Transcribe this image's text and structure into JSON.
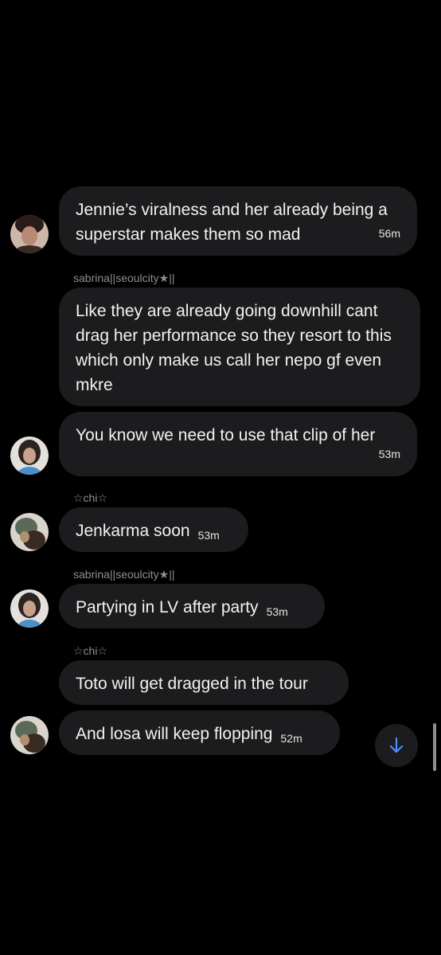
{
  "messages": [
    {
      "sender": "",
      "text": "Jennie’s viralness and her already being a superstar makes them so mad",
      "time": "56m"
    },
    {
      "sender": "sabrina||seoulcity★||",
      "text": "Like they are already going downhill cant drag her performance so they resort to this which only make us call her nepo gf even mkre",
      "time": ""
    },
    {
      "sender": "",
      "text": "You know we need to use that clip of her",
      "time": "53m"
    },
    {
      "sender": "☆chi☆",
      "text": "Jenkarma soon",
      "time": "53m"
    },
    {
      "sender": "sabrina||seoulcity★||",
      "text": "Partying in LV after party",
      "time": "53m"
    },
    {
      "sender": "☆chi☆",
      "text": "Toto will get dragged in the tour",
      "time": ""
    },
    {
      "sender": "",
      "text": "And losa will keep flopping",
      "time": "52m"
    }
  ],
  "colors": {
    "background": "#000000",
    "bubble": "#1c1c1e",
    "sender_text": "#8e8e93",
    "accent": "#4a8eff"
  },
  "icons": {
    "scroll_down": "arrow-down-icon"
  }
}
